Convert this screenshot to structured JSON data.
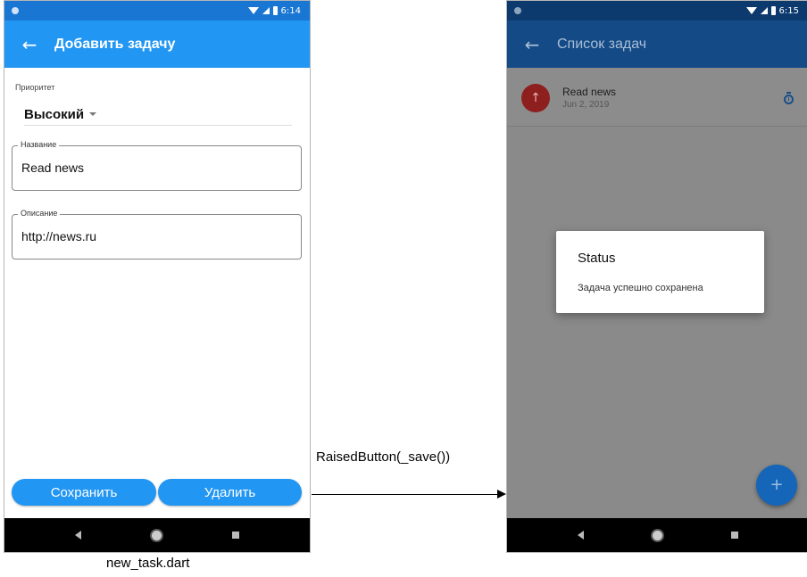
{
  "left_screen": {
    "status_time": "6:14",
    "appbar": {
      "back_icon": "←",
      "title": "Добавить задачу"
    },
    "priority": {
      "label": "Приоритет",
      "value": "Высокий"
    },
    "name_field": {
      "label": "Название",
      "value": "Read news"
    },
    "description_field": {
      "label": "Описание",
      "value": "http://news.ru"
    },
    "buttons": {
      "save": "Сохранить",
      "delete": "Удалить"
    }
  },
  "right_screen": {
    "status_time": "6:15",
    "appbar": {
      "back_icon": "←",
      "title": "Список задач"
    },
    "task": {
      "avatar_icon": "↑",
      "title": "Read news",
      "date": "Jun 2, 2019"
    },
    "dialog": {
      "title": "Status",
      "message": "Задача успешно сохранена"
    },
    "fab_icon": "+"
  },
  "annotations": {
    "arrow_label": "RaisedButton(_save())",
    "caption": "new_task.dart"
  }
}
